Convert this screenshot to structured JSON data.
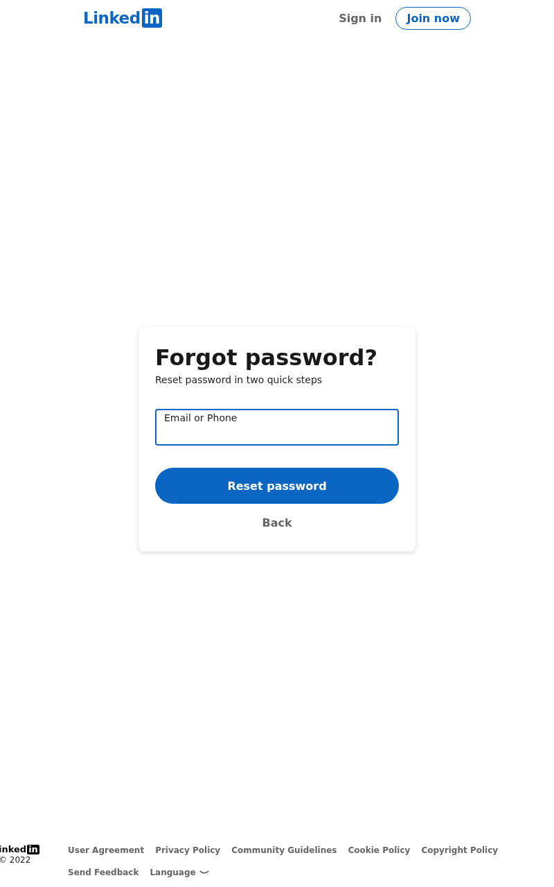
{
  "header": {
    "logo": {
      "word": "Linked",
      "badge": "in"
    },
    "sign_in": "Sign in",
    "join_now": "Join now"
  },
  "card": {
    "title": "Forgot password?",
    "subtitle": "Reset password in two quick steps",
    "field": {
      "label": "Email or Phone",
      "focused": true
    },
    "primary_button": "Reset password",
    "back_link": "Back"
  },
  "footer": {
    "logo": {
      "word": "inked",
      "badge": "in"
    },
    "copyright": "© 2022",
    "links": [
      {
        "label": "User Agreement",
        "kind": "link"
      },
      {
        "label": "Privacy Policy",
        "kind": "link"
      },
      {
        "label": "Community Guidelines",
        "kind": "link"
      },
      {
        "label": "Cookie Policy",
        "kind": "link"
      },
      {
        "label": "Copyright Policy",
        "kind": "link"
      },
      {
        "label": "Send Feedback",
        "kind": "link"
      },
      {
        "label": "Language",
        "kind": "dropdown"
      }
    ]
  }
}
